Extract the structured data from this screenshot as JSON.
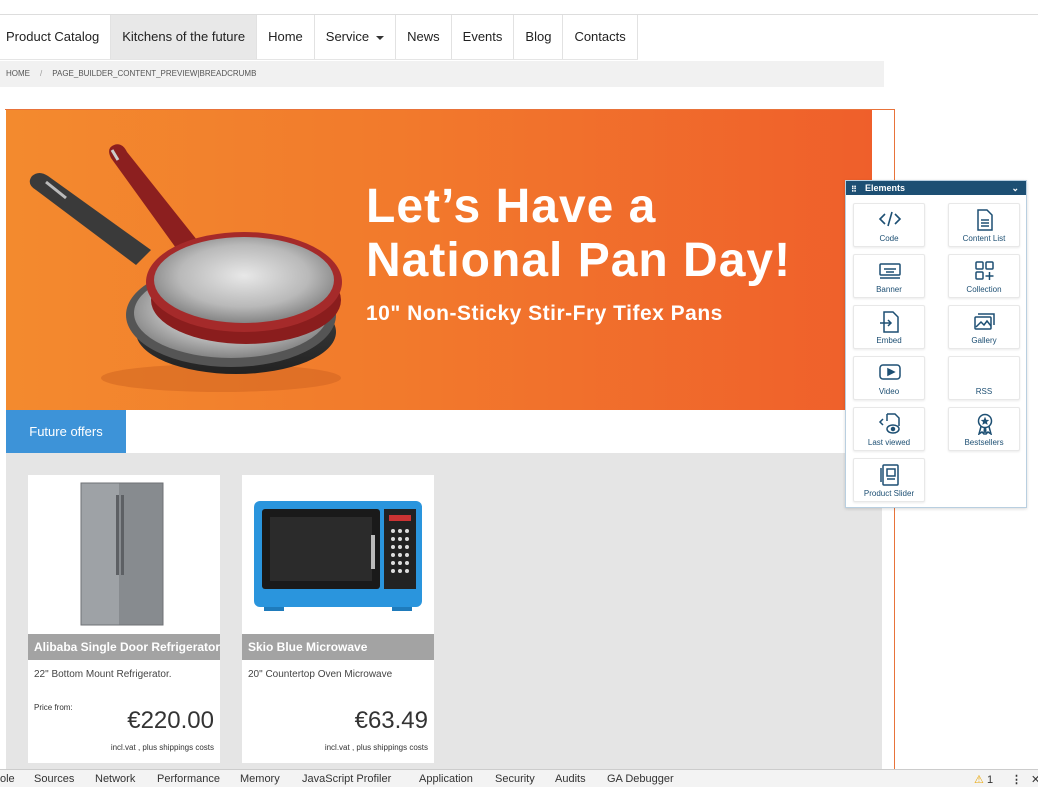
{
  "nav": {
    "items": [
      {
        "label": "Product Catalog"
      },
      {
        "label": "Kitchens of the future"
      },
      {
        "label": "Home"
      },
      {
        "label": "Service"
      },
      {
        "label": "News"
      },
      {
        "label": "Events"
      },
      {
        "label": "Blog"
      },
      {
        "label": "Contacts"
      }
    ],
    "active": "Kitchens of the future"
  },
  "breadcrumb": {
    "home": "HOME",
    "separator": "/",
    "current": "PAGE_BUILDER_CONTENT_PREVIEW|BREADCRUMB"
  },
  "banner": {
    "headline_line1": "Let’s Have a",
    "headline_line2": "National Pan Day!",
    "subline": "10\" Non-Sticky Stir-Fry Tifex Pans"
  },
  "tabs": {
    "active_label": "Future offers",
    "active_color": "#3d93d8"
  },
  "products": [
    {
      "title": "Alibaba Single Door Refrigerator",
      "description": "22\" Bottom Mount Refrigerator.",
      "price_from": "Price from:",
      "price": "€220.00",
      "vat_note": "incl.vat , plus shippings costs",
      "image": "refrigerator-image"
    },
    {
      "title": "Skio Blue Microwave",
      "description": "20\" Countertop Oven Microwave",
      "price": "€63.49",
      "vat_note": "incl.vat , plus shippings costs",
      "image": "microwave-image"
    }
  ],
  "elements_panel": {
    "title": "Elements",
    "items": [
      {
        "label": "Code",
        "icon": "code-icon"
      },
      {
        "label": "Content List",
        "icon": "document-list-icon"
      },
      {
        "label": "Banner",
        "icon": "banner-icon"
      },
      {
        "label": "Collection",
        "icon": "collection-grid-icon"
      },
      {
        "label": "Embed",
        "icon": "embed-icon"
      },
      {
        "label": "Gallery",
        "icon": "gallery-icon"
      },
      {
        "label": "Video",
        "icon": "video-play-icon"
      },
      {
        "label": "RSS",
        "icon": ""
      },
      {
        "label": "Last viewed",
        "icon": "last-viewed-icon"
      },
      {
        "label": "Bestsellers",
        "icon": "award-ribbon-icon"
      },
      {
        "label": "Product Slider",
        "icon": "product-slider-icon"
      }
    ],
    "header_color": "#1d4f73"
  },
  "devtools": {
    "tabs": [
      "ole",
      "Sources",
      "Network",
      "Performance",
      "Memory",
      "JavaScript Profiler",
      "Application",
      "Security",
      "Audits",
      "GA Debugger"
    ],
    "warning_count": "1"
  }
}
